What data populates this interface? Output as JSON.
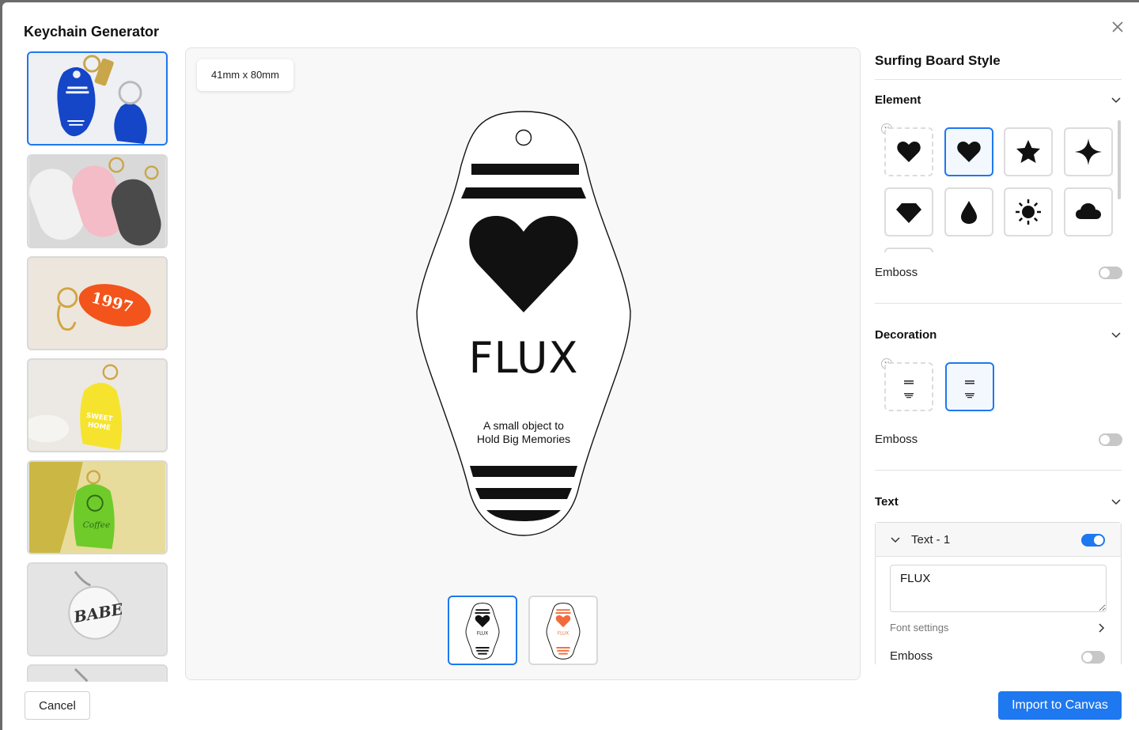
{
  "dialog": {
    "title": "Keychain Generator",
    "close_icon": "close-icon"
  },
  "thumbnails": [
    {
      "name": "blue-motel-keychain",
      "selected": true,
      "text": "LONGBOARD SURF"
    },
    {
      "name": "clear-pink-gray-keychains",
      "selected": false,
      "text": ""
    },
    {
      "name": "orange-1997-keychain",
      "selected": false,
      "text": "1997"
    },
    {
      "name": "yellow-sweet-home-keychain",
      "selected": false,
      "text": "SWEET HOME"
    },
    {
      "name": "green-coffee-keychain",
      "selected": false,
      "text": "Coffee"
    },
    {
      "name": "round-babe-keychain",
      "selected": false,
      "text": "BABE"
    },
    {
      "name": "partial-keychain",
      "selected": false,
      "text": ""
    }
  ],
  "preview": {
    "size_label": "41mm x 80mm",
    "keychain_name": "FLUX",
    "tagline_line1": "A small object to",
    "tagline_line2": "Hold Big Memories",
    "variants": [
      {
        "name": "variant-black",
        "selected": true,
        "color": "#111111",
        "label": "FLUX"
      },
      {
        "name": "variant-orange",
        "selected": false,
        "color": "#f26b3a",
        "label": "FLUX"
      }
    ]
  },
  "panel": {
    "title": "Surfing Board Style",
    "element": {
      "title": "Element",
      "icons": [
        "heart-icon",
        "heart-icon",
        "star-icon",
        "sparkle-icon",
        "diamond-icon",
        "drop-icon",
        "sun-icon",
        "cloud-icon"
      ],
      "selected_index": 1,
      "emboss_label": "Emboss",
      "emboss_on": false
    },
    "decoration": {
      "title": "Decoration",
      "emboss_label": "Emboss",
      "emboss_on": false
    },
    "text": {
      "title": "Text",
      "item_label": "Text - 1",
      "item_enabled": true,
      "value": "FLUX",
      "font_settings_label": "Font settings",
      "emboss_label": "Emboss",
      "emboss_on": false
    }
  },
  "footer": {
    "cancel_label": "Cancel",
    "import_label": "Import to Canvas"
  },
  "colors": {
    "accent": "#1e78f0",
    "border": "#dcdcdc"
  }
}
